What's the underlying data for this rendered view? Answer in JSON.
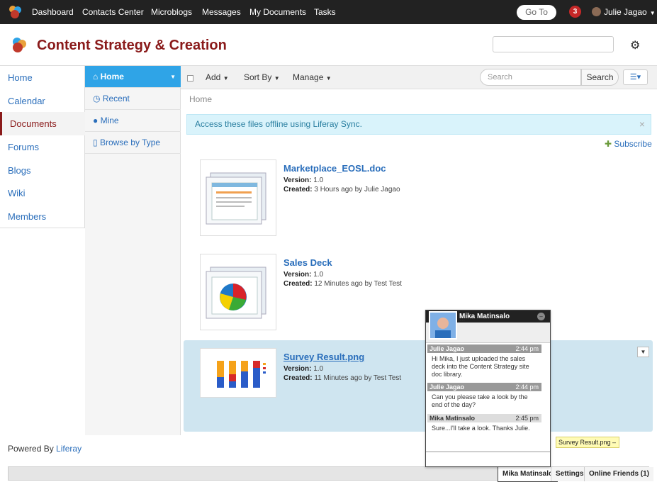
{
  "topbar": {
    "nav": [
      "Dashboard",
      "Contacts Center",
      "Microblogs",
      "Messages",
      "My Documents",
      "Tasks"
    ],
    "goto_label": "Go To",
    "notification_count": "3",
    "user_name": "Julie Jagao"
  },
  "site": {
    "title": "Content Strategy & Creation"
  },
  "left_nav": {
    "items": [
      "Home",
      "Calendar",
      "Documents",
      "Forums",
      "Blogs",
      "Wiki",
      "Members"
    ],
    "active": "Documents"
  },
  "doc_nav": {
    "items": [
      "Home",
      "Recent",
      "Mine",
      "Browse by Type"
    ],
    "active": "Home"
  },
  "toolbar": {
    "add": "Add",
    "sort_by": "Sort By",
    "manage": "Manage",
    "search_placeholder": "Search",
    "search_button": "Search"
  },
  "breadcrumb": "Home",
  "alert": {
    "text": "Access these files offline using Liferay Sync.",
    "close": "×"
  },
  "subscribe": "Subscribe",
  "entries": [
    {
      "title": "Marketplace_EOSL.doc",
      "version_label": "Version:",
      "version": "1.0",
      "created_label": "Created:",
      "created": "3 Hours ago by Julie Jagao"
    },
    {
      "title": "Sales Deck",
      "version_label": "Version:",
      "version": "1.0",
      "created_label": "Created:",
      "created": "12 Minutes ago by Test Test"
    },
    {
      "title": "Survey Result.png",
      "version_label": "Version:",
      "version": "1.0",
      "created_label": "Created:",
      "created": "11 Minutes ago by Test Test"
    }
  ],
  "footer": {
    "powered_by": "Powered By",
    "brand": "Liferay"
  },
  "dock": {
    "chat_user": "Mika Matinsalo",
    "settings": "Settings",
    "online_friends": "Online Friends (1)"
  },
  "chat": {
    "name": "Mika Matinsalo",
    "status": "...",
    "messages": [
      {
        "from": "Julie Jagao",
        "time": "2:44 pm",
        "text": "Hi Mika, I just uploaded the sales deck into the Content Strategy site doc library."
      },
      {
        "from": "Julie Jagao",
        "time": "2:44 pm",
        "text": "Can you please take a look by the end of the day?"
      },
      {
        "from": "Mika Matinsalo",
        "time": "2:45 pm",
        "text": "Sure...I'll take a look. Thanks Julie."
      }
    ]
  },
  "tooltip": "Survey Result.png –",
  "colors": {
    "brand_red": "#8a1a1a",
    "accent_blue": "#2fa4e7",
    "link_blue": "#2a6ebb",
    "selected_row": "#cfe5f0"
  }
}
